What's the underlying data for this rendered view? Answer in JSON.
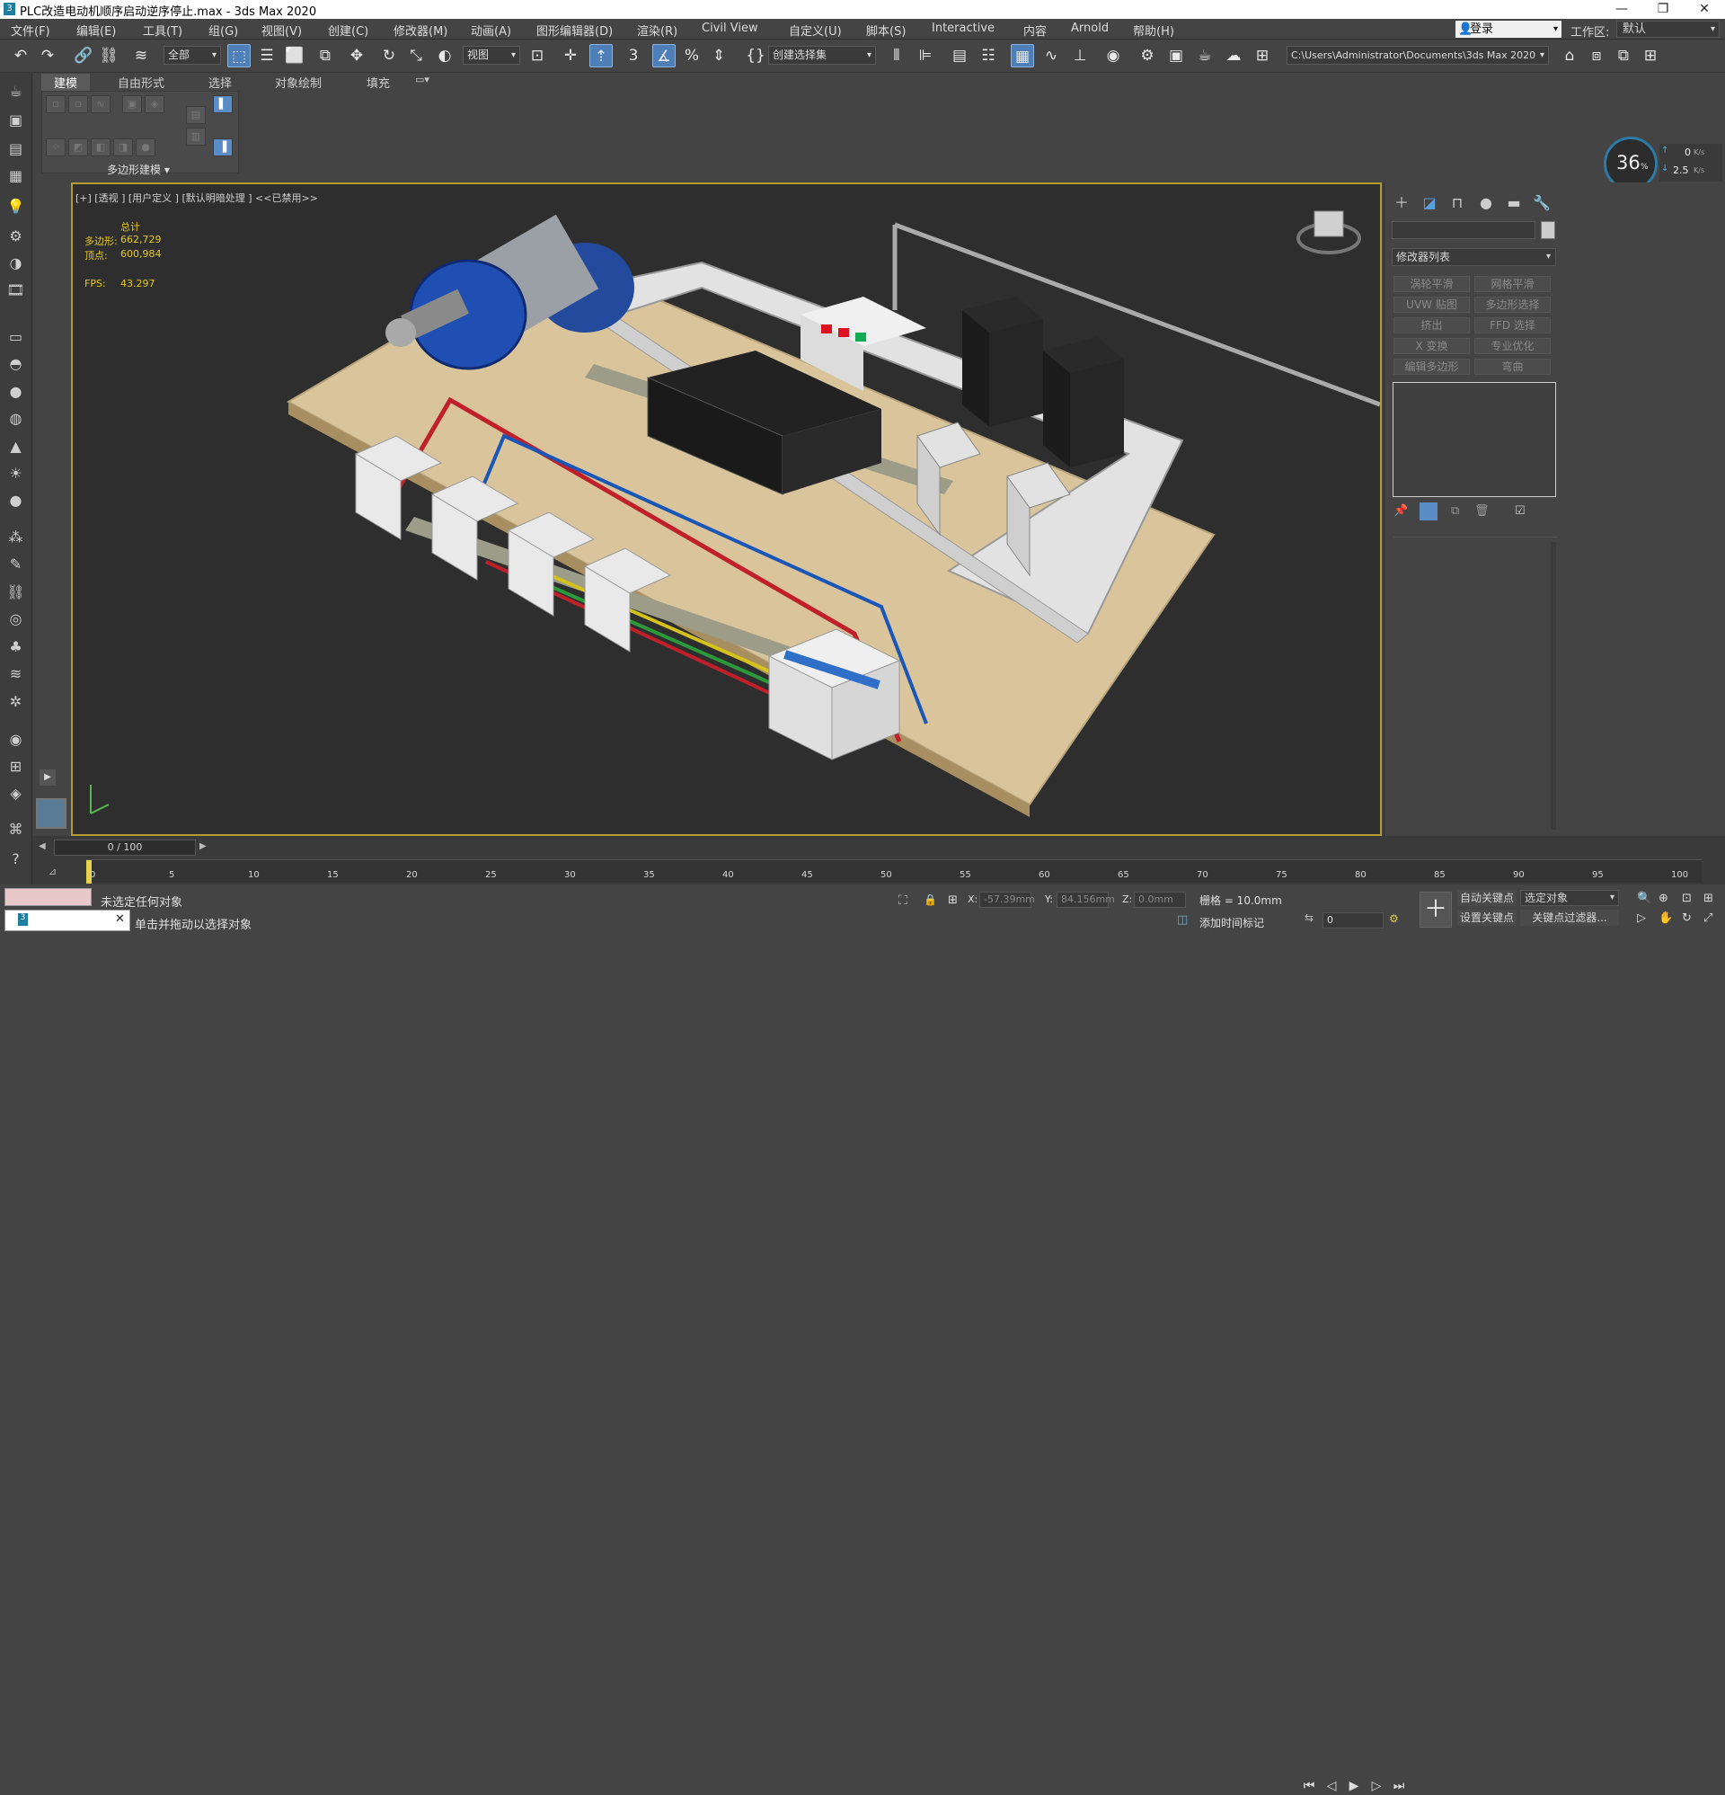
{
  "title": "PLC改造电动机顺序启动逆序停止.max - 3ds Max 2020",
  "menu": [
    "文件(F)",
    "编辑(E)",
    "工具(T)",
    "组(G)",
    "视图(V)",
    "创建(C)",
    "修改器(M)",
    "动画(A)",
    "图形编辑器(D)",
    "渲染(R)",
    "Civil View",
    "自定义(U)",
    "脚本(S)",
    "Interactive",
    "内容",
    "Arnold",
    "帮助(H)"
  ],
  "login": "登录",
  "workspace_label": "工作区:",
  "workspace_value": "默认",
  "toolbar": {
    "filter": "全部",
    "coord": "视图",
    "selset": "创建选择集",
    "path": "C:\\Users\\Administrator\\Documents\\3ds Max 2020"
  },
  "ribbon_tabs": [
    "建模",
    "自由形式",
    "选择",
    "对象绘制",
    "填充"
  ],
  "ribbon_group": "多边形建模",
  "viewport_label": "[+] [透视 ] [用户定义 ] [默认明暗处理 ] <<已禁用>>",
  "stats": {
    "total": "总计",
    "poly_label": "多边形:",
    "poly": "662,729",
    "vert_label": "顶点:",
    "vert": "600,984",
    "fps_label": "FPS:",
    "fps": "43.297"
  },
  "perf": {
    "percent": "36",
    "percent_unit": "%",
    "up": "0",
    "up_unit": "K/s",
    "down": "2.5",
    "down_unit": "K/s"
  },
  "cmdpanel": {
    "modifier_list": "修改器列表",
    "buttons": [
      "涡轮平滑",
      "网格平滑",
      "UVW 贴图",
      "多边形选择",
      "挤出",
      "FFD 选择",
      "X 变换",
      "专业优化",
      "编辑多边形",
      "弯曲"
    ]
  },
  "timeline": {
    "frame": "0 / 100",
    "ticks": [
      "0",
      "5",
      "10",
      "15",
      "20",
      "25",
      "30",
      "35",
      "40",
      "45",
      "50",
      "55",
      "60",
      "65",
      "70",
      "75",
      "80",
      "85",
      "90",
      "95",
      "100"
    ]
  },
  "status": {
    "line1": "未选定任何对象",
    "line2": "单击并拖动以选择对象",
    "x_label": "X:",
    "x": "-57.39mm",
    "y_label": "Y:",
    "y": "84.156mm",
    "z_label": "Z:",
    "z": "0.0mm",
    "grid": "栅格 = 10.0mm",
    "add_time_tag": "添加时间标记",
    "auto_key": "自动关键点",
    "set_key": "设置关键点",
    "selected_obj": "选定对象",
    "key_filter": "关键点过滤器...",
    "frame_spin": "0"
  }
}
